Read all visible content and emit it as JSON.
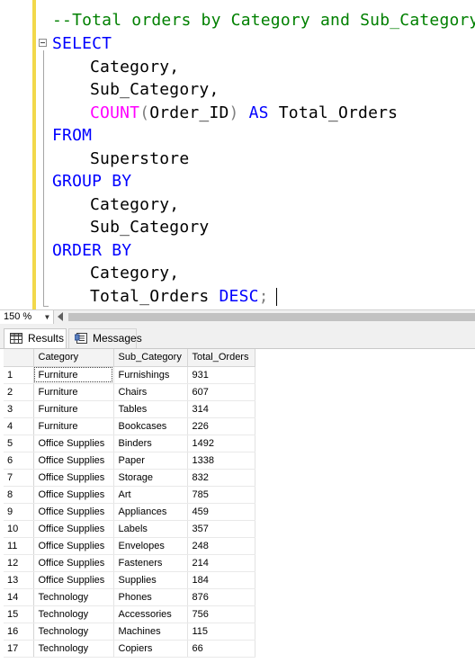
{
  "editor": {
    "comment": "--Total orders by Category and Sub_Category",
    "kw_select": "SELECT",
    "line_category": "Category,",
    "line_sub_category": "Sub_Category,",
    "fn_count": "COUNT",
    "paren_open": "(",
    "count_arg": "Order_ID",
    "paren_close": ")",
    "kw_as": "AS",
    "alias": "Total_Orders",
    "kw_from": "FROM",
    "table": "Superstore",
    "kw_group_by": "GROUP BY",
    "group_category": "Category,",
    "group_sub_category": "Sub_Category",
    "kw_order_by": "ORDER BY",
    "order_category": "Category,",
    "order_total": "Total_Orders",
    "kw_desc": "DESC",
    "semicolon": ";"
  },
  "zoom": {
    "value": "150 %"
  },
  "tabs": {
    "results": "Results",
    "messages": "Messages"
  },
  "grid": {
    "columns": [
      "Category",
      "Sub_Category",
      "Total_Orders"
    ],
    "rows": [
      [
        "1",
        "Furniture",
        "Furnishings",
        "931"
      ],
      [
        "2",
        "Furniture",
        "Chairs",
        "607"
      ],
      [
        "3",
        "Furniture",
        "Tables",
        "314"
      ],
      [
        "4",
        "Furniture",
        "Bookcases",
        "226"
      ],
      [
        "5",
        "Office Supplies",
        "Binders",
        "1492"
      ],
      [
        "6",
        "Office Supplies",
        "Paper",
        "1338"
      ],
      [
        "7",
        "Office Supplies",
        "Storage",
        "832"
      ],
      [
        "8",
        "Office Supplies",
        "Art",
        "785"
      ],
      [
        "9",
        "Office Supplies",
        "Appliances",
        "459"
      ],
      [
        "10",
        "Office Supplies",
        "Labels",
        "357"
      ],
      [
        "11",
        "Office Supplies",
        "Envelopes",
        "248"
      ],
      [
        "12",
        "Office Supplies",
        "Fasteners",
        "214"
      ],
      [
        "13",
        "Office Supplies",
        "Supplies",
        "184"
      ],
      [
        "14",
        "Technology",
        "Phones",
        "876"
      ],
      [
        "15",
        "Technology",
        "Accessories",
        "756"
      ],
      [
        "16",
        "Technology",
        "Machines",
        "115"
      ],
      [
        "17",
        "Technology",
        "Copiers",
        "66"
      ]
    ]
  },
  "icons": {
    "results_tab": "grid-icon",
    "messages_tab": "messages-icon",
    "fold": "collapse-minus-icon",
    "zoom_dropdown": "chevron-down-icon",
    "scroll_left": "scroll-left-arrow-icon"
  },
  "colors": {
    "keyword": "#0000ff",
    "function": "#ff00ff",
    "comment": "#008000",
    "punctuation": "#808080",
    "change_bar": "#f2d84a"
  }
}
